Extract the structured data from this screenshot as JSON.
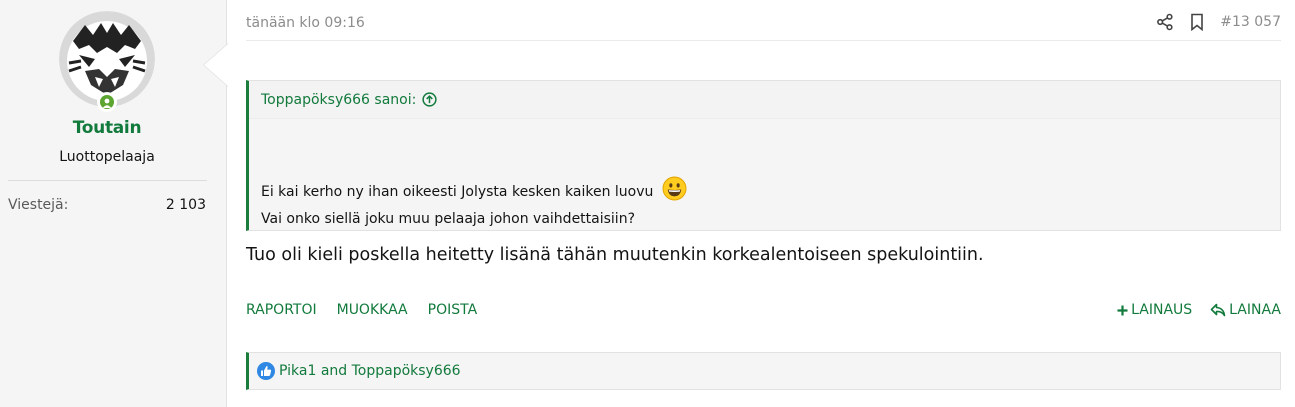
{
  "user": {
    "name": "Toutain",
    "title": "Luottopelaaja",
    "stats": [
      {
        "label": "Viestejä:",
        "value": "2 103"
      }
    ]
  },
  "post": {
    "date": "tänään klo 09:16",
    "number": "#13 057",
    "quote": {
      "author": "Toppapöksy666 sanoi:",
      "lines": [
        "Ei kai kerho ny ihan oikeesti Jolysta kesken kaiken luovu",
        "Vai onko siellä joku muu pelaaja johon vaihdettaisiin?"
      ]
    },
    "message": "Tuo oli kieli poskella heitetty lisänä tähän muutenkin korkealentoiseen spekulointiin."
  },
  "actions": {
    "left": [
      "RAPORTOI",
      "MUOKKAA",
      "POISTA"
    ],
    "lainaus": "LAINAUS",
    "lainaa": "LAINAA"
  },
  "reactions": {
    "users": "Pika1 and Toppapöksy666"
  },
  "colors": {
    "accent": "#127a3c",
    "online": "#5da531",
    "like": "#2f88e3"
  },
  "icons": [
    "share-icon",
    "bookmark-icon",
    "arrow-up-circle-icon",
    "grin-emoji-icon",
    "plus-icon",
    "reply-icon",
    "like-icon"
  ]
}
